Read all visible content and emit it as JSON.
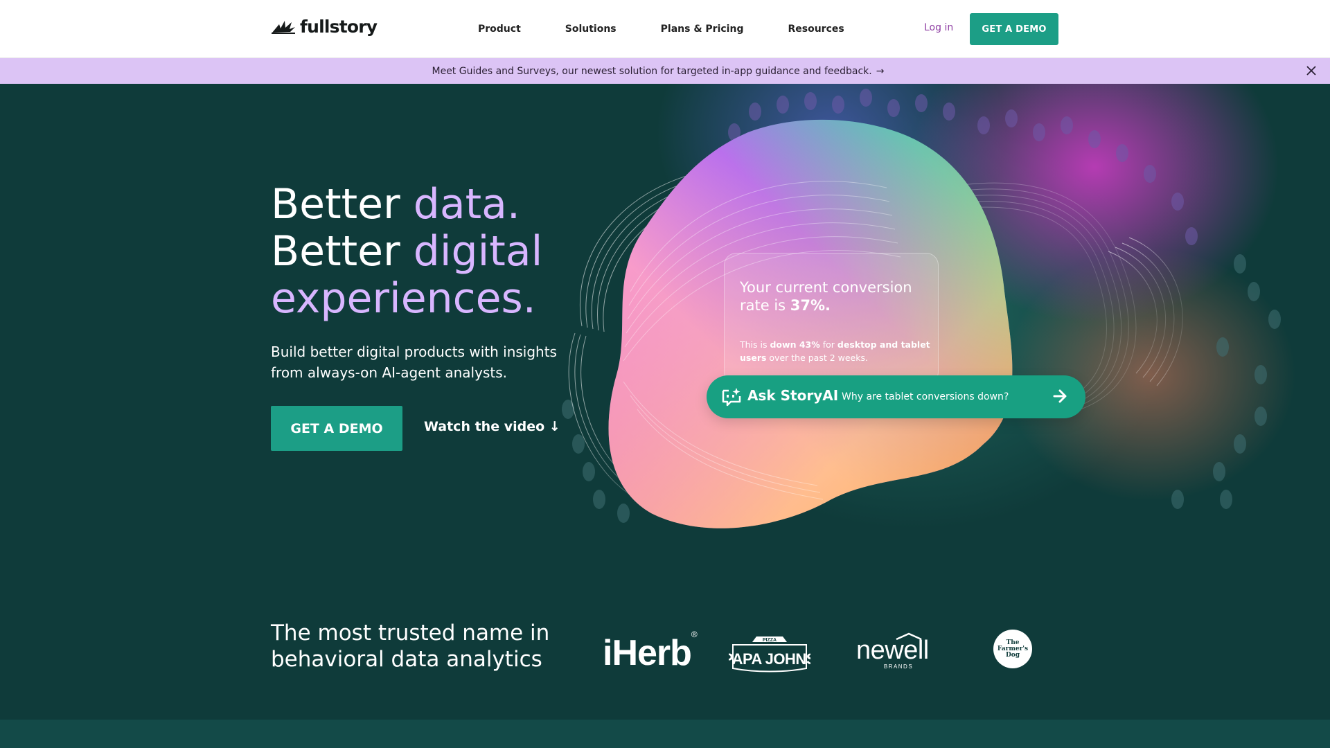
{
  "nav": {
    "logo_text": "fullstory",
    "items": [
      {
        "label": "Product"
      },
      {
        "label": "Solutions"
      },
      {
        "label": "Plans & Pricing"
      },
      {
        "label": "Resources"
      }
    ],
    "login_label": "Log in",
    "demo_label": "GET A DEMO"
  },
  "announcement": {
    "text": "Meet Guides and Surveys, our newest solution for targeted in-app guidance and feedback.",
    "arrow": "→"
  },
  "hero": {
    "headline": [
      {
        "a": "Better ",
        "b": "data."
      },
      {
        "a": "Better ",
        "b": "digital"
      },
      {
        "a": "",
        "b": "experiences."
      }
    ],
    "subtitle": "Build better digital products with insights from always-on AI-agent analysts.",
    "demo_label": "GET A DEMO",
    "watch_label": "Watch the video ↓"
  },
  "card": {
    "title_pre": "Your current conversion rate is ",
    "title_value": "37%.",
    "note_pre": "This is ",
    "note_b1": "down 43%",
    "note_mid": " for ",
    "note_b2": "desktop and tablet users",
    "note_post": " over the past 2 weeks."
  },
  "ask": {
    "brand": "Ask StoryAI",
    "question": "Why are tablet conversions down?"
  },
  "trusted": {
    "line1": "The most trusted name in",
    "line2": "behavioral data analytics",
    "logos": {
      "iherb": "iHerb",
      "iherb_mark": "®",
      "papa_top": "PIZZA",
      "papa": "PAPA JOHNS",
      "newell": "newell",
      "newell_sub": "BRANDS",
      "farmer": [
        "The",
        "Farmer's",
        "Dog"
      ]
    }
  },
  "colors": {
    "background": "#0f3b3a",
    "accent": "#1c9e86",
    "headline_accent": "#d8b6ff",
    "banner": "#dcc4f5",
    "login": "#8f3fa3"
  }
}
